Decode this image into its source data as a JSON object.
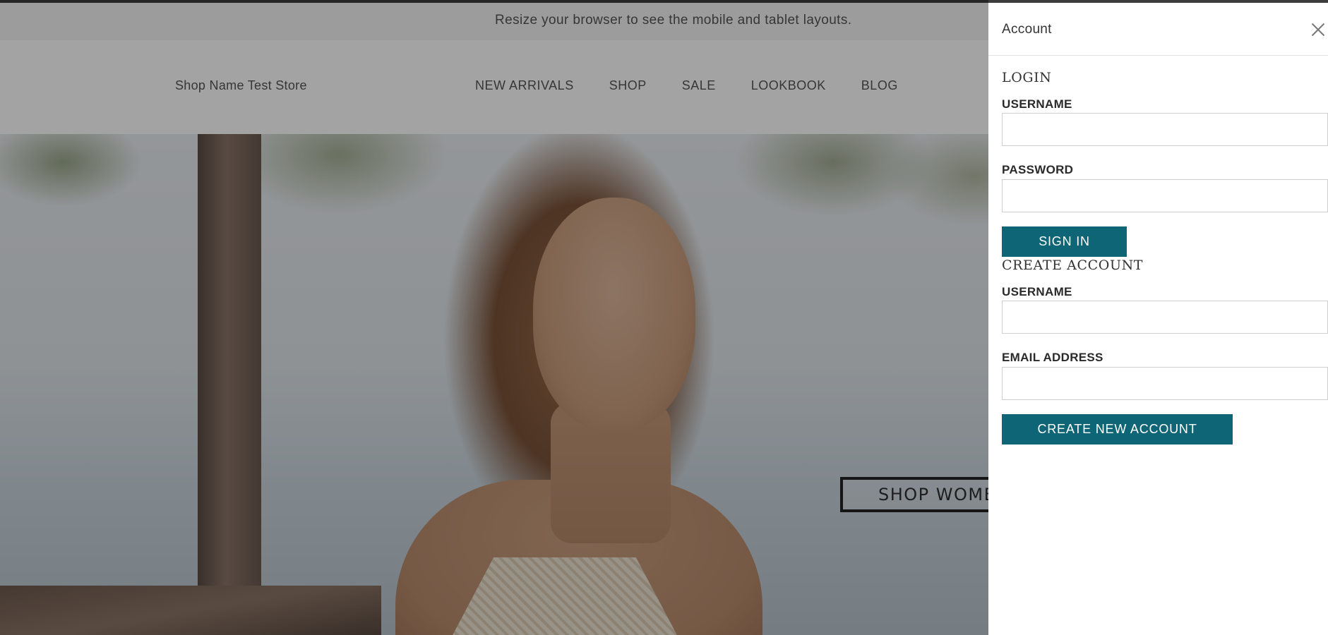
{
  "banner": {
    "text": "Resize your browser to see the mobile and tablet layouts."
  },
  "header": {
    "brand": "Shop Name Test Store",
    "nav": [
      "NEW ARRIVALS",
      "SHOP",
      "SALE",
      "LOOKBOOK",
      "BLOG"
    ]
  },
  "hero": {
    "cta_label": "SHOP WOMEN"
  },
  "drawer": {
    "title": "Account",
    "login": {
      "heading": "LOGIN",
      "username_label": "USERNAME",
      "username_value": "",
      "password_label": "PASSWORD",
      "password_value": "",
      "submit_label": "SIGN IN"
    },
    "create": {
      "heading": "CREATE ACCOUNT",
      "username_label": "USERNAME",
      "username_value": "",
      "email_label": "EMAIL ADDRESS",
      "email_value": "",
      "submit_label": "CREATE NEW ACCOUNT"
    }
  },
  "colors": {
    "accent": "#0e6576",
    "overlay": "rgba(0,0,0,0.36)"
  }
}
